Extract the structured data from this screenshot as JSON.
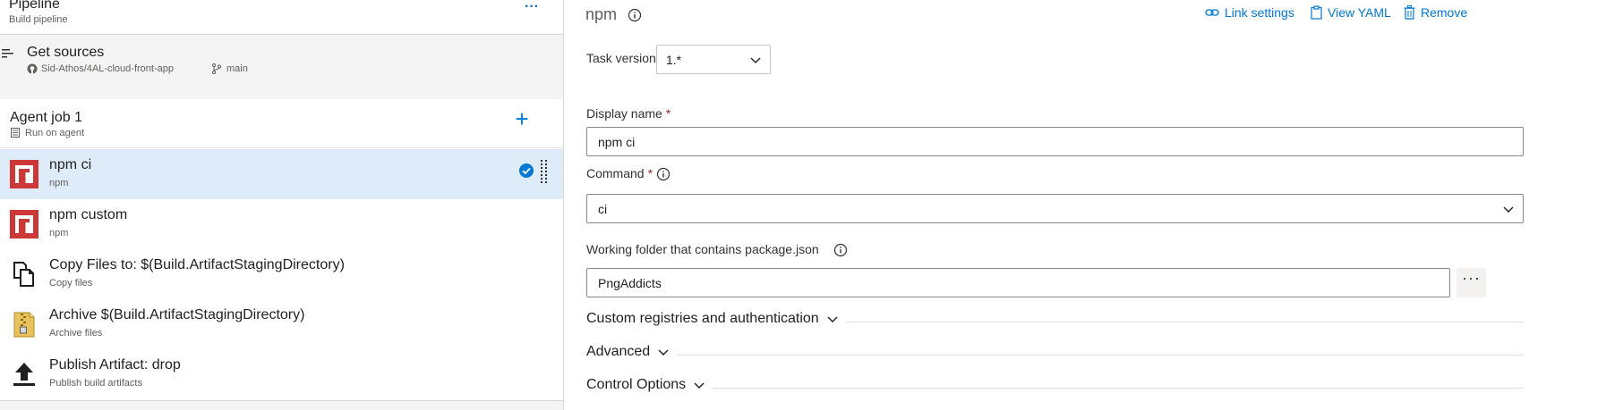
{
  "pipeline": {
    "title": "Pipeline",
    "subtitle": "Build pipeline",
    "more_label": "···"
  },
  "get_sources": {
    "title": "Get sources",
    "repository": "Sid-Athos/4AL-cloud-front-app",
    "branch": "main",
    "icons": [
      "sources-icon",
      "github-icon",
      "branch-icon"
    ]
  },
  "agent_job": {
    "title": "Agent job 1",
    "subtitle": "Run on agent",
    "add_label": "+"
  },
  "tasks": [
    {
      "name": "npm ci",
      "subtitle": "npm",
      "icon": "npm-icon",
      "selected": true
    },
    {
      "name": "npm custom",
      "subtitle": "npm",
      "icon": "npm-icon",
      "selected": false
    },
    {
      "name": "Copy Files to: $(Build.ArtifactStagingDirectory)",
      "subtitle": "Copy files",
      "icon": "copy-files-icon",
      "selected": false
    },
    {
      "name": "Archive $(Build.ArtifactStagingDirectory)",
      "subtitle": "Archive files",
      "icon": "archive-icon",
      "selected": false
    },
    {
      "name": "Publish Artifact: drop",
      "subtitle": "Publish build artifacts",
      "icon": "publish-icon",
      "selected": false
    }
  ],
  "details": {
    "task_type": "npm",
    "toolbar": {
      "link_settings": "Link settings",
      "view_yaml": "View YAML",
      "remove": "Remove"
    },
    "task_version": {
      "label": "Task version",
      "value": "1.*"
    },
    "display_name": {
      "label": "Display name",
      "required_mark": "*",
      "value": "npm ci"
    },
    "command": {
      "label": "Command",
      "required_mark": "*",
      "value": "ci"
    },
    "working_folder": {
      "label": "Working folder that contains package.json",
      "value": "PngAddicts",
      "browse_label": "···"
    },
    "sections": [
      {
        "title": "Custom registries and authentication"
      },
      {
        "title": "Advanced"
      },
      {
        "title": "Control Options"
      }
    ]
  },
  "colors": {
    "accent": "#0078d4",
    "selected_row": "#deecf9",
    "npm_red": "#cb3837",
    "required": "#a4262c"
  }
}
